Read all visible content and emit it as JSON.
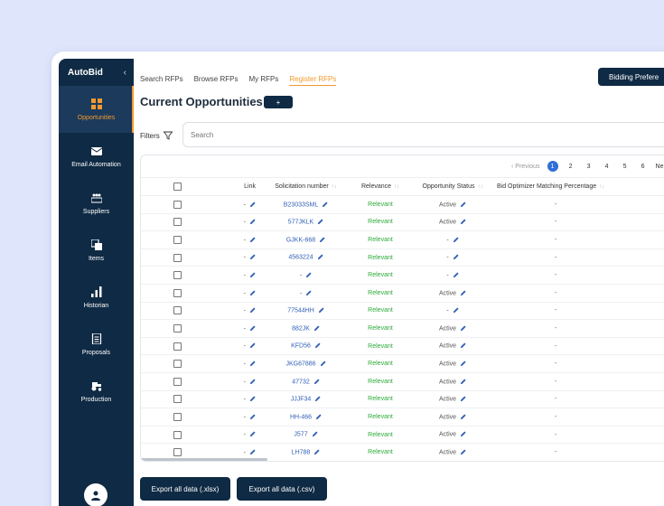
{
  "app": {
    "title": "AutoBid",
    "collapse_icon": "chevron-left-icon"
  },
  "sidebar": {
    "items": [
      {
        "label": "Opportunities",
        "icon": "grid-icon",
        "active": true
      },
      {
        "label": "Email Automation",
        "icon": "mail-icon",
        "active": false
      },
      {
        "label": "Suppliers",
        "icon": "suppliers-icon",
        "active": false
      },
      {
        "label": "Items",
        "icon": "items-icon",
        "active": false
      },
      {
        "label": "Historian",
        "icon": "bar-chart-icon",
        "active": false
      },
      {
        "label": "Proposals",
        "icon": "document-icon",
        "active": false
      },
      {
        "label": "Production",
        "icon": "tractor-icon",
        "active": false
      }
    ],
    "avatar_icon": "user-icon"
  },
  "tabs": [
    "Search RFPs",
    "Browse RFPs",
    "My RFPs",
    "Register RFPs"
  ],
  "active_tab": "Register RFPs",
  "header": {
    "bidding_button": "Bidding Prefere",
    "title": "Current Opportunities",
    "add_button": "+"
  },
  "filters": {
    "label": "Filters",
    "search_placeholder": "Search"
  },
  "pagination": {
    "previous": "Previous",
    "pages": [
      "1",
      "2",
      "3",
      "4",
      "5",
      "6"
    ],
    "active_page": "1",
    "next": "Ne"
  },
  "table": {
    "columns": [
      "Link",
      "Solicitation number",
      "Relevance",
      "Opportunity Status",
      "Bid Optimizer Matching Percentage"
    ],
    "rows": [
      {
        "link": "-",
        "sol": "B23033SML",
        "rel": "Relevant",
        "status": "Active",
        "pct": "-"
      },
      {
        "link": "-",
        "sol": "577JKLK",
        "rel": "Relevant",
        "status": "Active",
        "pct": "-"
      },
      {
        "link": "-",
        "sol": "GJKK-668",
        "rel": "Relevant",
        "status": "-",
        "pct": "-"
      },
      {
        "link": "-",
        "sol": "4563224",
        "rel": "Relevant",
        "status": "-",
        "pct": "-"
      },
      {
        "link": "-",
        "sol": "-",
        "rel": "Relevant",
        "status": "-",
        "pct": "-"
      },
      {
        "link": "-",
        "sol": "-",
        "rel": "Relevant",
        "status": "Active",
        "pct": "-"
      },
      {
        "link": "-",
        "sol": "77544HH",
        "rel": "Relevant",
        "status": "-",
        "pct": "-"
      },
      {
        "link": "-",
        "sol": "882JK",
        "rel": "Relevant",
        "status": "Active",
        "pct": "-"
      },
      {
        "link": "-",
        "sol": "KFD56",
        "rel": "Relevant",
        "status": "Active",
        "pct": "-"
      },
      {
        "link": "-",
        "sol": "JKG67886",
        "rel": "Relevant",
        "status": "Active",
        "pct": "-"
      },
      {
        "link": "-",
        "sol": "47732",
        "rel": "Relevant",
        "status": "Active",
        "pct": "-"
      },
      {
        "link": "-",
        "sol": "JJJF34",
        "rel": "Relevant",
        "status": "Active",
        "pct": "-"
      },
      {
        "link": "-",
        "sol": "HH-466",
        "rel": "Relevant",
        "status": "Active",
        "pct": "-"
      },
      {
        "link": "-",
        "sol": "J577",
        "rel": "Relevant",
        "status": "Active",
        "pct": "-"
      },
      {
        "link": "-",
        "sol": "LH788",
        "rel": "Relevant",
        "status": "Active",
        "pct": "-"
      }
    ]
  },
  "export": {
    "xlsx": "Export all data (.xlsx)",
    "csv": "Export all data (.csv)"
  },
  "colors": {
    "navy": "#0f2a44",
    "accent": "#f29a2e",
    "link": "#2f5fb6",
    "relevant": "#2eaa3a",
    "page_active": "#2f6fd6"
  }
}
